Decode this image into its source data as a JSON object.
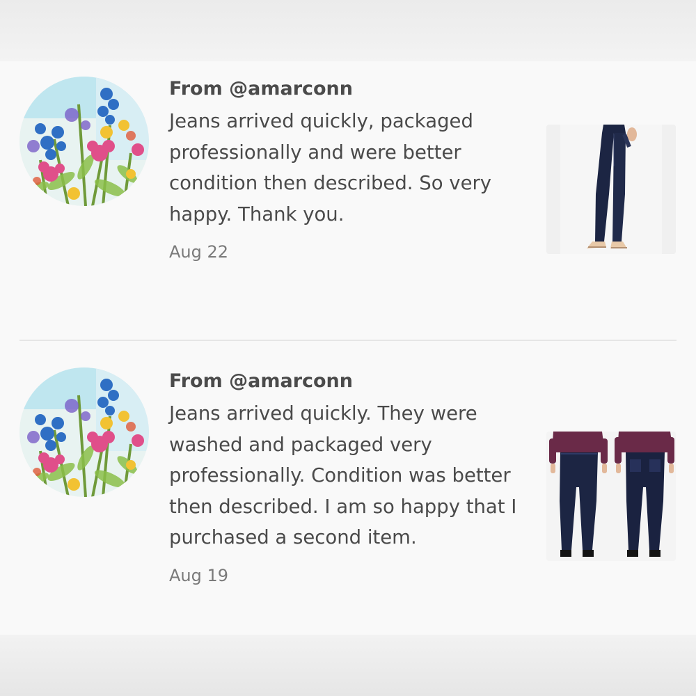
{
  "reviews": [
    {
      "from": "From @amarconn",
      "text": "Jeans arrived quickly, packaged professionally and were better condition then described. So very happy. Thank you.",
      "date": "Aug 22",
      "avatar_icon": "floral-watercolor-avatar",
      "thumbnail_icon": "jeans-single-model-thumbnail"
    },
    {
      "from": "From @amarconn",
      "text": "Jeans arrived quickly. They were washed and packaged very professionally. Condition was better then described. I am so happy that I purchased a second item.",
      "date": "Aug 19",
      "avatar_icon": "floral-watercolor-avatar",
      "thumbnail_icon": "jeans-front-back-thumbnail"
    }
  ],
  "colors": {
    "denim": "#1c2543",
    "blouse": "#6a2a48",
    "text": "#4a4a4a",
    "date": "#7a7a7a",
    "divider": "#e6e6e6"
  }
}
